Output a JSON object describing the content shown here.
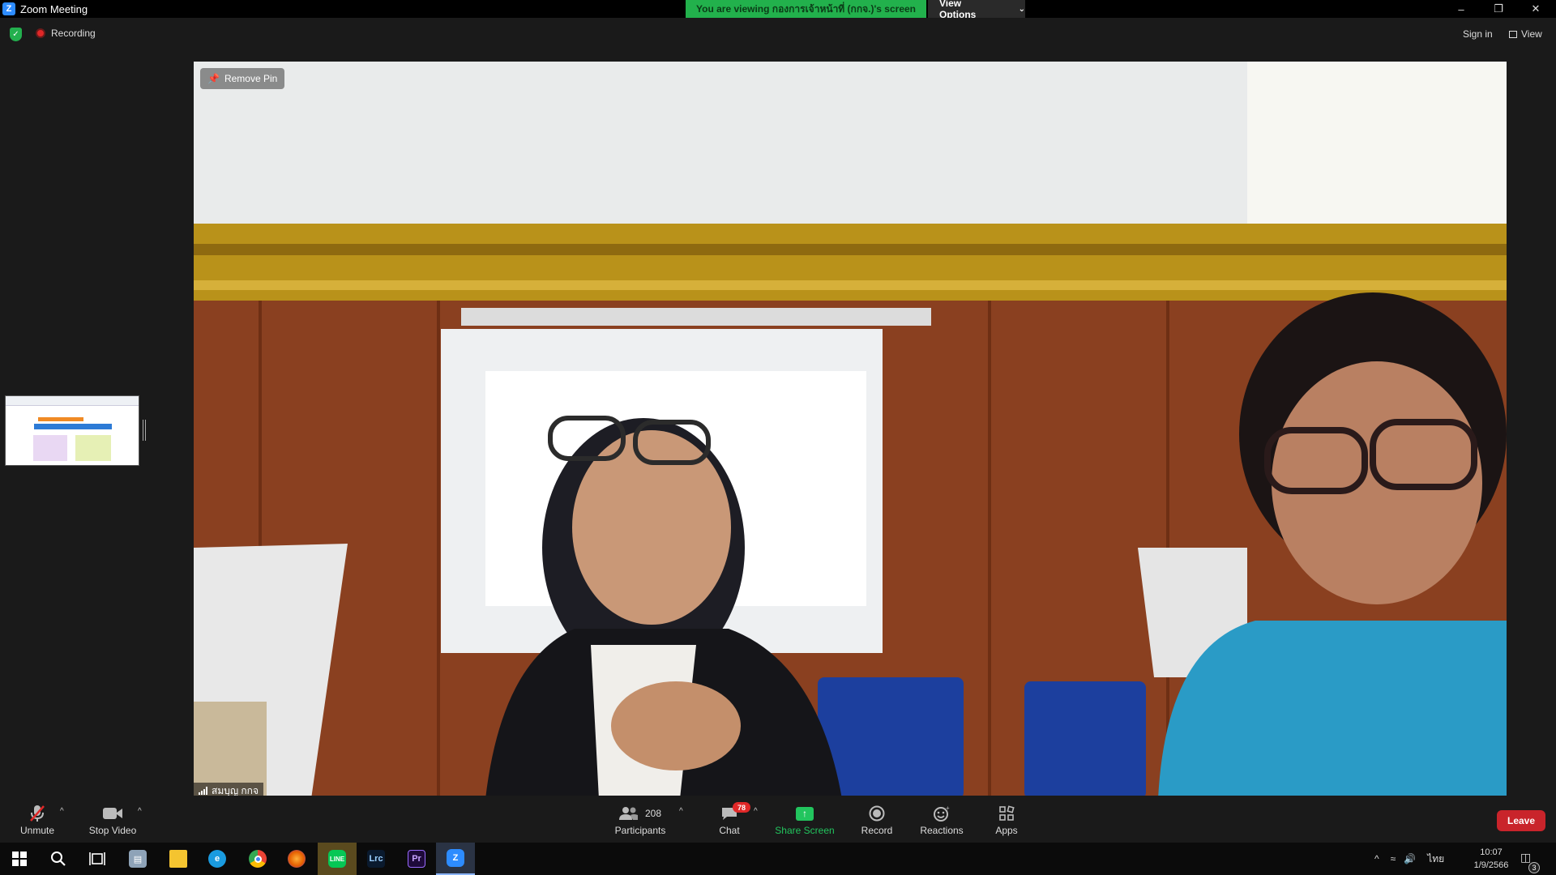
{
  "window": {
    "title": "Zoom Meeting",
    "app_icon_letter": "Z",
    "controls": [
      "minimize",
      "restore",
      "close"
    ]
  },
  "banner": {
    "viewing_text": "You are viewing กองการเจ้าหน้าที่ (กกจ.)'s screen",
    "view_options_label": "View Options"
  },
  "status": {
    "recording_label": "Recording",
    "sign_in_label": "Sign in",
    "view_label": "View"
  },
  "video": {
    "remove_pin_label": "Remove Pin",
    "participant_name": "สมบุญ กกจ"
  },
  "controls": {
    "unmute": "Unmute",
    "stop_video": "Stop Video",
    "participants": "Participants",
    "participants_count": "208",
    "chat": "Chat",
    "chat_badge": "78",
    "share_screen": "Share Screen",
    "record": "Record",
    "reactions": "Reactions",
    "apps": "Apps",
    "leave": "Leave"
  },
  "taskbar": {
    "apps": [
      "windows-start",
      "search",
      "task-view",
      "notes",
      "file-explorer",
      "edge",
      "chrome",
      "firefox",
      "line",
      "lightroom-classic",
      "premiere-pro",
      "zoom"
    ],
    "lrc_label": "Lrc",
    "pr_label": "Pr",
    "language": "ไทย",
    "time": "10:07",
    "date": "1/9/2566",
    "notification_count": "3"
  },
  "colors": {
    "banner_green": "#22b14c",
    "leave_red": "#c9242b",
    "share_green": "#22c55e",
    "chat_badge_red": "#e02828"
  }
}
